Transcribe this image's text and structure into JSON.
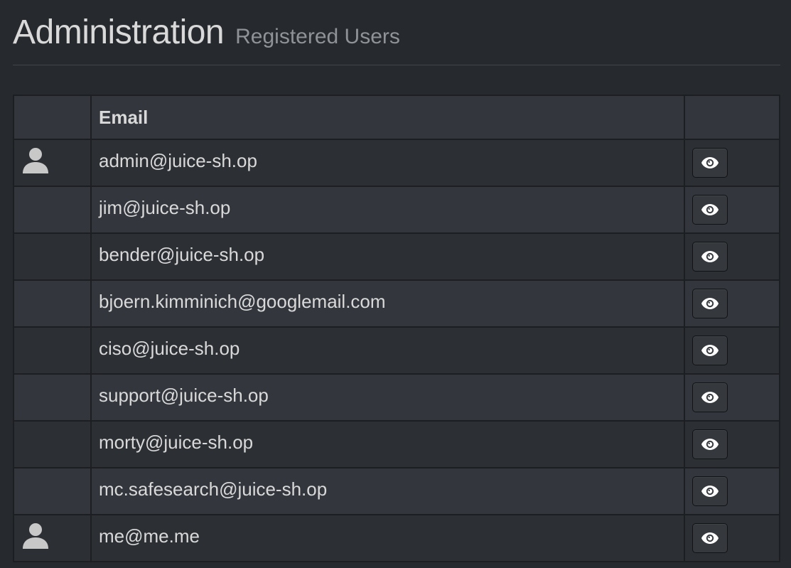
{
  "header": {
    "title": "Administration",
    "subtitle": "Registered Users"
  },
  "table": {
    "columns": [
      "",
      "Email",
      ""
    ],
    "rows": [
      {
        "email": "admin@juice-sh.op",
        "avatar": true
      },
      {
        "email": "jim@juice-sh.op",
        "avatar": false
      },
      {
        "email": "bender@juice-sh.op",
        "avatar": false
      },
      {
        "email": "bjoern.kimminich@googlemail.com",
        "avatar": false
      },
      {
        "email": "ciso@juice-sh.op",
        "avatar": false
      },
      {
        "email": "support@juice-sh.op",
        "avatar": false
      },
      {
        "email": "morty@juice-sh.op",
        "avatar": false
      },
      {
        "email": "mc.safesearch@juice-sh.op",
        "avatar": false
      },
      {
        "email": "me@me.me",
        "avatar": true
      }
    ]
  },
  "icons": {
    "avatar": "user-icon",
    "view": "eye-icon"
  },
  "colors": {
    "background": "#26292e",
    "row_odd": "#2c2f34",
    "row_even": "#33373d",
    "text": "#d9d9d9",
    "subtitle": "#8f9296"
  }
}
